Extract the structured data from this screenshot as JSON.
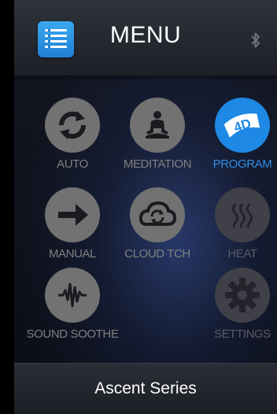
{
  "header": {
    "title": "MENU",
    "menu_icon": "list-icon",
    "status_icon": "bluetooth-icon"
  },
  "tiles": [
    {
      "label": "AUTO",
      "icon": "sync-arrows-icon",
      "state": "normal"
    },
    {
      "label": "MEDITATION",
      "icon": "meditation-person-icon",
      "state": "normal"
    },
    {
      "label": "PROGRAM",
      "icon": "4d-badge-icon",
      "state": "active",
      "badge_text": "4D"
    },
    {
      "label": "MANUAL",
      "icon": "arrow-right-icon",
      "state": "normal"
    },
    {
      "label": "CLOUD TCH",
      "icon": "cloud-sync-icon",
      "state": "normal"
    },
    {
      "label": "HEAT",
      "icon": "heat-waves-icon",
      "state": "disabled"
    },
    {
      "label": "SOUND SOOTHE",
      "icon": "sound-wave-icon",
      "state": "normal"
    },
    {
      "label": "SETTINGS",
      "icon": "gear-icon",
      "state": "disabled"
    }
  ],
  "footer": {
    "text": "Ascent Series"
  },
  "colors": {
    "accent": "#1e88e5",
    "icon_bg": "#727272",
    "disabled_bg": "#3f4048"
  }
}
